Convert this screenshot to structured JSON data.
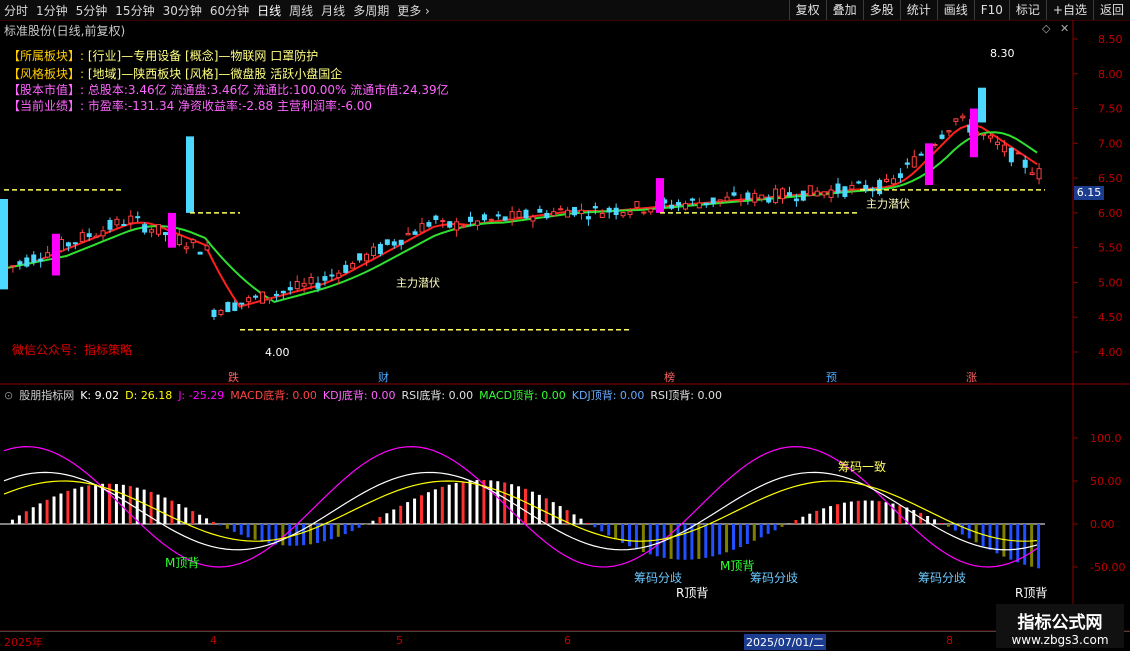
{
  "toolbar": {
    "periods": [
      "分时",
      "1分钟",
      "5分钟",
      "15分钟",
      "30分钟",
      "60分钟",
      "日线",
      "周线",
      "月线",
      "多周期",
      "更多"
    ],
    "buttons": [
      "复权",
      "叠加",
      "多股",
      "统计",
      "画线",
      "F10",
      "标记",
      "+自选",
      "返回"
    ]
  },
  "chart_title": "标准股份(日线,前复权)",
  "info_panel": {
    "row1_key": "【所属板块】:",
    "row1_val": "[行业]—专用设备 [概念]—物联网 口罩防护",
    "row2_key": "【风格板块】:",
    "row2_val": "[地域]—陕西板块 [风格]—微盘股 活跃小盘国企",
    "row3_key": "【股本市值】:",
    "row3_val": "总股本:3.46亿 流通盘:3.46亿 流通比:100.00% 流通市值:24.39亿",
    "row4_key": "【当前业绩】:",
    "row4_val": "市盈率:-131.34 净资收益率:-2.88 主营利润率:-6.00"
  },
  "wechat_note": "微信公众号：指标策略",
  "price_axis": [
    "8.50",
    "8.00",
    "7.50",
    "7.00",
    "6.50",
    "6.00",
    "5.50",
    "5.00",
    "4.50",
    "4.00"
  ],
  "current_price": "6.15",
  "high_label": "8.30",
  "low_label": "4.00",
  "main_force_label": "主力潜伏",
  "event_markers": [
    "跌",
    "财",
    "榜",
    "预",
    "涨"
  ],
  "indicator": {
    "name": "股朋指标网",
    "k": "K: 9.02",
    "d": "D: 26.18",
    "j": "J: -25.29",
    "macd_bottom": "MACD底背: 0.00",
    "kdj_bottom": "KDJ底背: 0.00",
    "rsi_bottom": "RSI底背: 0.00",
    "macd_top": "MACD顶背: 0.00",
    "kdj_top": "KDJ顶背: 0.00",
    "rsi_top": "RSI顶背: 0.00",
    "axis": [
      "100.0",
      "50.00",
      "0.00",
      "-50.00"
    ],
    "labels": {
      "m_top": "M顶背",
      "r_top": "R顶背",
      "chip_div": "筹码分歧",
      "chip_agree": "筹码一致"
    }
  },
  "dates": [
    "2025年",
    "4",
    "5",
    "6",
    "2025/07/01/二",
    "8"
  ],
  "watermark": {
    "line1": "指标公式网",
    "line2": "www.zbgs3.com"
  }
}
